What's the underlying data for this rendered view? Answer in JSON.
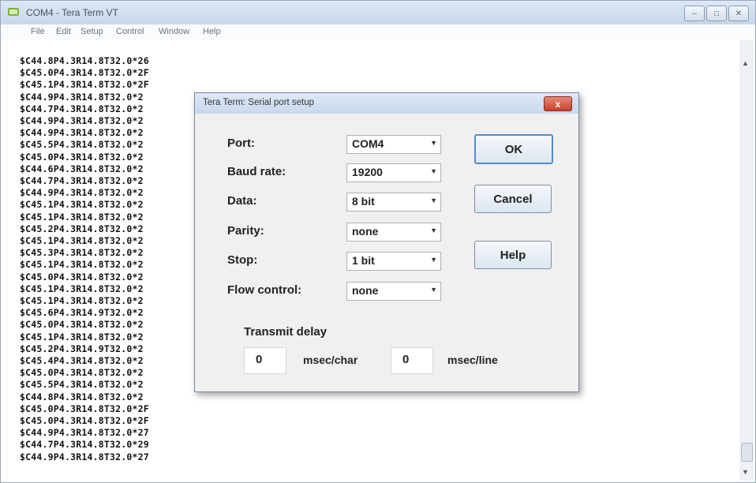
{
  "window": {
    "title": "COM4 - Tera Term VT"
  },
  "menu": [
    "File",
    "Edit",
    "Setup",
    "Control",
    "Window",
    "Help"
  ],
  "terminal_lines": [
    "$C44.8P4.3R14.8T32.0*26",
    "$C45.0P4.3R14.8T32.0*2F",
    "$C45.1P4.3R14.8T32.0*2F",
    "$C44.9P4.3R14.8T32.0*2",
    "$C44.7P4.3R14.8T32.0*2",
    "$C44.9P4.3R14.8T32.0*2",
    "$C44.9P4.3R14.8T32.0*2",
    "$C45.5P4.3R14.8T32.0*2",
    "$C45.0P4.3R14.8T32.0*2",
    "$C44.6P4.3R14.8T32.0*2",
    "$C44.7P4.3R14.8T32.0*2",
    "$C44.9P4.3R14.8T32.0*2",
    "$C45.1P4.3R14.8T32.0*2",
    "$C45.1P4.3R14.8T32.0*2",
    "$C45.2P4.3R14.8T32.0*2",
    "$C45.1P4.3R14.8T32.0*2",
    "$C45.3P4.3R14.8T32.0*2",
    "$C45.1P4.3R14.8T32.0*2",
    "$C45.0P4.3R14.8T32.0*2",
    "$C45.1P4.3R14.8T32.0*2",
    "$C45.1P4.3R14.8T32.0*2",
    "$C45.6P4.3R14.9T32.0*2",
    "$C45.0P4.3R14.8T32.0*2",
    "$C45.1P4.3R14.8T32.0*2",
    "$C45.2P4.3R14.9T32.0*2",
    "$C45.4P4.3R14.8T32.0*2",
    "$C45.0P4.3R14.8T32.0*2",
    "$C45.5P4.3R14.8T32.0*2",
    "$C44.8P4.3R14.8T32.0*2",
    "$C45.0P4.3R14.8T32.0*2F",
    "$C45.0P4.3R14.8T32.0*2F",
    "$C44.9P4.3R14.8T32.0*27",
    "$C44.7P4.3R14.8T32.0*29",
    "$C44.9P4.3R14.8T32.0*27"
  ],
  "dialog": {
    "title": "Tera Term: Serial port setup",
    "close_label": "x",
    "fields": [
      {
        "label": "Port:",
        "value": "COM4"
      },
      {
        "label": "Baud rate:",
        "value": "19200"
      },
      {
        "label": "Data:",
        "value": "8 bit"
      },
      {
        "label": "Parity:",
        "value": "none"
      },
      {
        "label": "Stop:",
        "value": "1 bit"
      },
      {
        "label": "Flow control:",
        "value": "none"
      }
    ],
    "buttons": {
      "ok": "OK",
      "cancel": "Cancel",
      "help": "Help"
    },
    "transmit_delay": {
      "label": "Transmit delay",
      "char_value": "0",
      "char_unit": "msec/char",
      "line_value": "0",
      "line_unit": "msec/line"
    }
  },
  "colors": {
    "titlebar": "#c6d6ea",
    "dialog_bg": "#f0f0f0",
    "close_button": "#c7402c",
    "default_button_border": "#4d8fd1"
  },
  "icons": {
    "app": "tera-term-icon",
    "minimize": "minimize-icon",
    "maximize": "maximize-icon",
    "close": "close-icon",
    "dropdown": "chevron-down-icon"
  }
}
